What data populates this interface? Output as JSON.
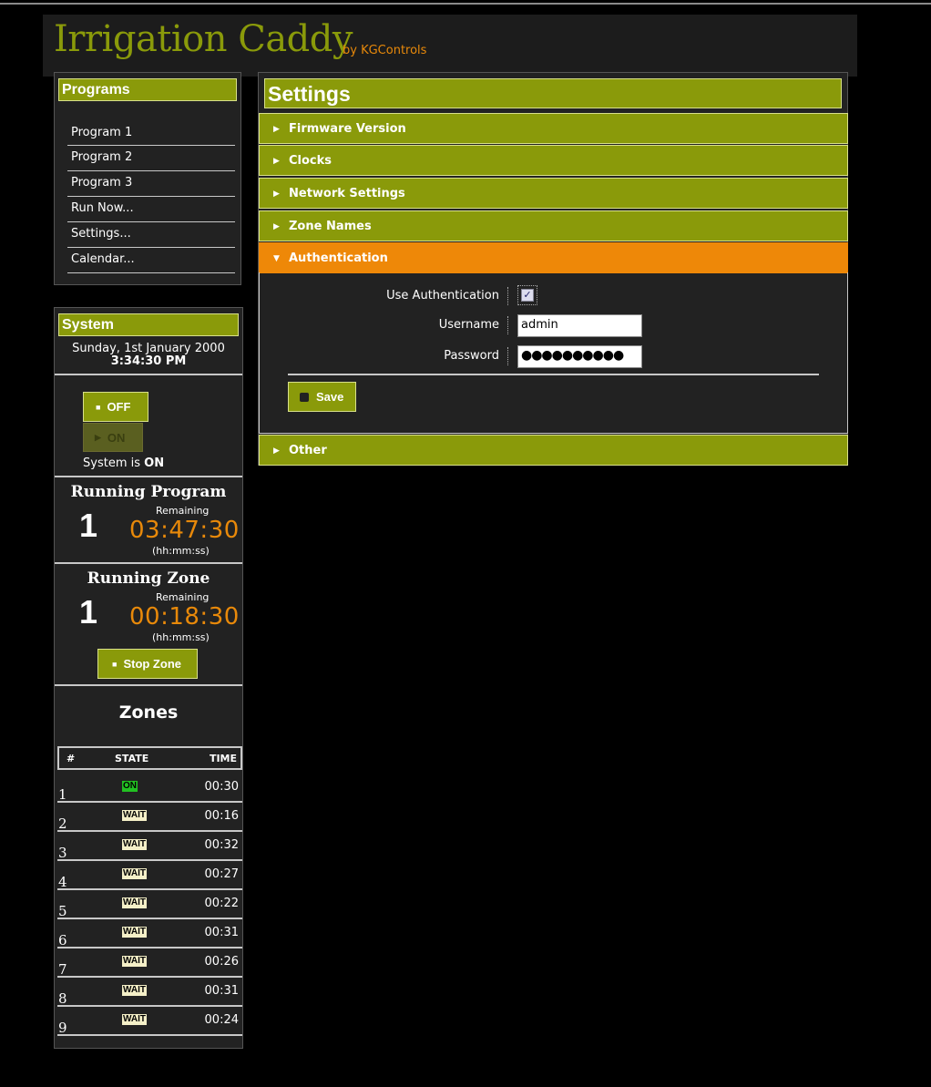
{
  "header": {
    "title": "Irrigation Caddy",
    "byline": "by KGControls"
  },
  "programs": {
    "title": "Programs",
    "items": [
      "Program 1",
      "Program 2",
      "Program 3",
      "Run Now...",
      "Settings...",
      "Calendar..."
    ]
  },
  "system": {
    "title": "System",
    "date": "Sunday, 1st January 2000",
    "time": "3:34:30 PM",
    "off_label": "OFF",
    "on_label": "ON",
    "status_prefix": "System is",
    "status_value": "ON"
  },
  "running_program": {
    "title": "Running Program",
    "number": "1",
    "remaining_label": "Remaining",
    "countdown": "03:47:30",
    "format": "(hh:mm:ss)"
  },
  "running_zone": {
    "title": "Running Zone",
    "number": "1",
    "remaining_label": "Remaining",
    "countdown": "00:18:30",
    "format": "(hh:mm:ss)",
    "stop_label": "Stop Zone"
  },
  "zones": {
    "title": "Zones",
    "headers": {
      "num": "#",
      "state": "STATE",
      "time": "TIME"
    },
    "rows": [
      {
        "num": "1",
        "state": "ON",
        "time": "00:30"
      },
      {
        "num": "2",
        "state": "WAIT",
        "time": "00:16"
      },
      {
        "num": "3",
        "state": "WAIT",
        "time": "00:32"
      },
      {
        "num": "4",
        "state": "WAIT",
        "time": "00:27"
      },
      {
        "num": "5",
        "state": "WAIT",
        "time": "00:22"
      },
      {
        "num": "6",
        "state": "WAIT",
        "time": "00:31"
      },
      {
        "num": "7",
        "state": "WAIT",
        "time": "00:26"
      },
      {
        "num": "8",
        "state": "WAIT",
        "time": "00:31"
      },
      {
        "num": "9",
        "state": "WAIT",
        "time": "00:24"
      }
    ]
  },
  "settings": {
    "title": "Settings",
    "sections": [
      "Firmware Version",
      "Clocks",
      "Network Settings",
      "Zone Names",
      "Authentication",
      "Other"
    ],
    "active_section": "Authentication",
    "auth": {
      "use_auth_label": "Use Authentication",
      "use_auth_checked": true,
      "username_label": "Username",
      "username_value": "admin",
      "password_label": "Password",
      "password_value": "●●●●●●●●●●",
      "save_label": "Save"
    }
  },
  "colors": {
    "accent": "#8a9a0a",
    "active": "#ee8808",
    "countdown": "#e8890a",
    "on_badge": "#22c022",
    "wait_badge": "#f5f0c8"
  }
}
